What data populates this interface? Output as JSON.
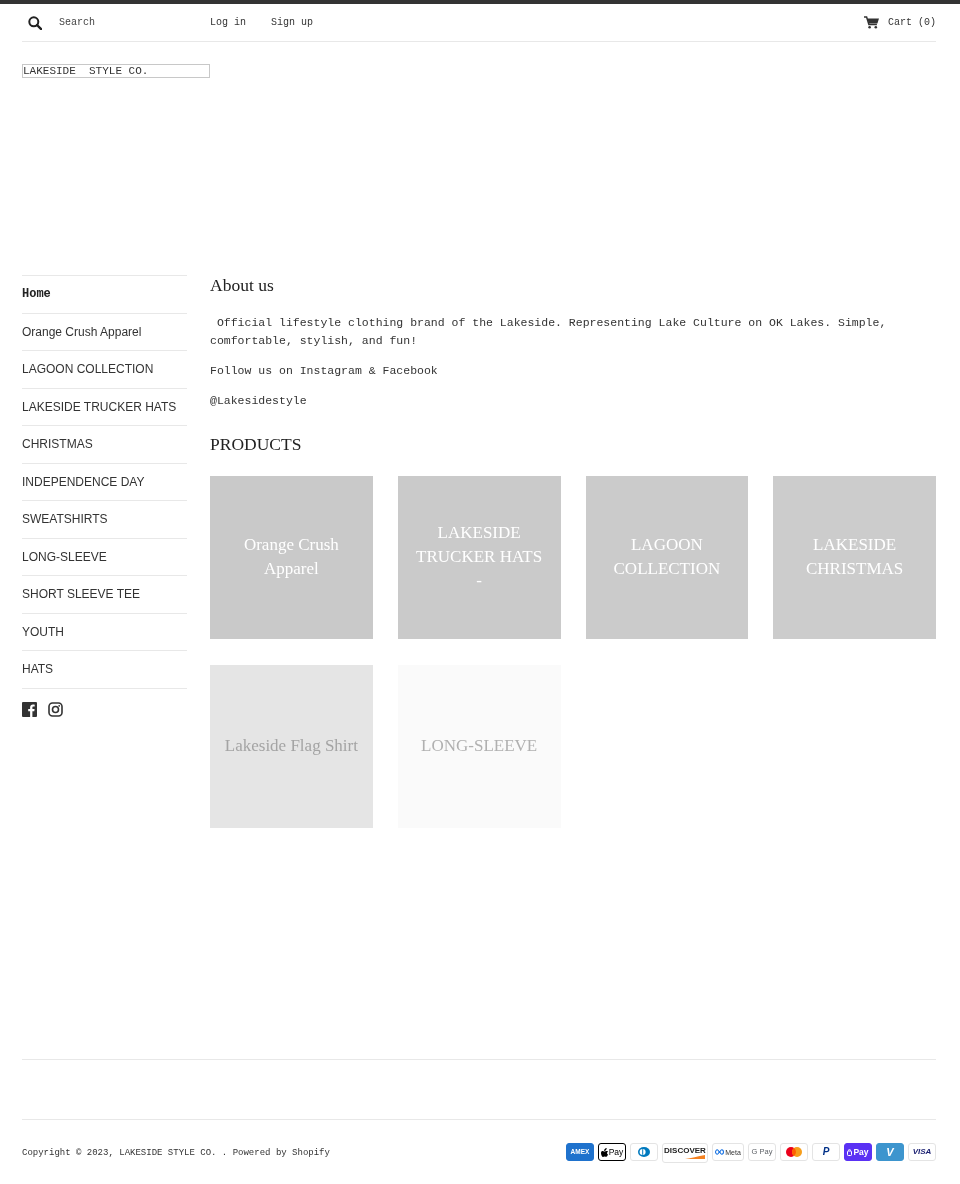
{
  "header": {
    "search": {
      "placeholder": "Search"
    },
    "links": [
      "Log in",
      "Sign up"
    ],
    "cart": "Cart (0)"
  },
  "logo": {
    "text": "LAKESIDE  STYLE CO."
  },
  "sidebar": {
    "items": [
      {
        "label": "Home",
        "selected": true
      },
      {
        "label": "Orange Crush Apparel",
        "selected": false
      },
      {
        "label": "LAGOON COLLECTION",
        "selected": false
      },
      {
        "label": "LAKESIDE TRUCKER HATS",
        "selected": false
      },
      {
        "label": "CHRISTMAS",
        "selected": false
      },
      {
        "label": "INDEPENDENCE DAY",
        "selected": false
      },
      {
        "label": "SWEATSHIRTS",
        "selected": false
      },
      {
        "label": "LONG-SLEEVE",
        "selected": false
      },
      {
        "label": "SHORT SLEEVE TEE",
        "selected": false
      },
      {
        "label": "YOUTH",
        "selected": false
      },
      {
        "label": "HATS",
        "selected": false
      }
    ],
    "social": [
      {
        "kind": "facebook"
      },
      {
        "kind": "instagram"
      }
    ]
  },
  "about": {
    "title": "About us",
    "paragraphs": [
      " Official lifestyle clothing brand of the Lakeside. Representing Lake Culture on OK Lakes. Simple, comfortable, stylish, and fun!",
      "Follow us on Instagram & Facebook",
      "@Lakesidestyle"
    ]
  },
  "products": {
    "title": "PRODUCTS",
    "tiles": [
      {
        "label": "Orange Crush Apparel",
        "color": "#c9c9c9"
      },
      {
        "label": "LAKESIDE TRUCKER HATS -",
        "color": "#cacaca"
      },
      {
        "label": "LAGOON COLLECTION",
        "color": "#cbcbcb"
      },
      {
        "label": "LAKESIDE CHRISTMAS",
        "color": "#cccccc"
      },
      {
        "label": "Lakeside Flag Shirt",
        "color": "#e5e5e5"
      },
      {
        "label": "LONG-SLEEVE",
        "color": "#fafafa"
      }
    ]
  },
  "footer": {
    "copyright": {
      "notice": "Copyright © 2023,",
      "store": "LAKESIDE STYLE CO.",
      "separator": ".",
      "powered": "Powered by Shopify"
    },
    "payments": [
      {
        "kind": "amex",
        "label": "AMEX"
      },
      {
        "kind": "apple",
        "label": "Pay"
      },
      {
        "kind": "diners"
      },
      {
        "kind": "discover",
        "label": "DISCOVER"
      },
      {
        "kind": "meta",
        "label": "Meta"
      },
      {
        "kind": "google",
        "label": "G Pay"
      },
      {
        "kind": "mastercard"
      },
      {
        "kind": "paypal",
        "label": "P"
      },
      {
        "kind": "shop",
        "label": "Pay"
      },
      {
        "kind": "venmo",
        "label": "V"
      },
      {
        "kind": "visa",
        "label": "VISA"
      }
    ]
  }
}
